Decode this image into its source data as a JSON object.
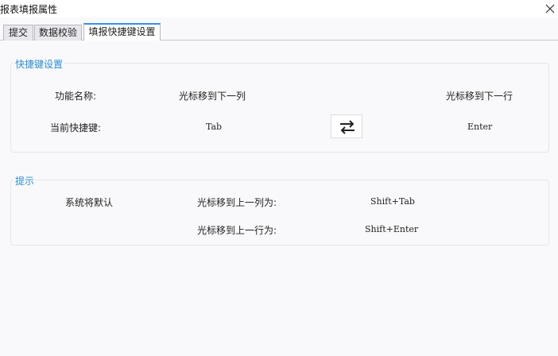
{
  "window": {
    "title": "报表填报属性",
    "close_icon": "close-icon"
  },
  "tabs": [
    {
      "label": "提交",
      "active": false
    },
    {
      "label": "数据校验",
      "active": false
    },
    {
      "label": "填报快捷键设置",
      "active": true
    }
  ],
  "shortcut_group": {
    "title": "快捷键设置",
    "function_label": "功能名称:",
    "function_col": "光标移到下一列",
    "function_row": "光标移到下一行",
    "current_label": "当前快捷键:",
    "current_col": "Tab",
    "current_row": "Enter",
    "swap_icon": "swap-arrows-icon"
  },
  "hint_group": {
    "title": "提示",
    "default_label": "系统将默认",
    "prev_col_label": "光标移到上一列为:",
    "prev_col_value": "Shift+Tab",
    "prev_row_label": "光标移到上一行为:",
    "prev_row_value": "Shift+Enter"
  },
  "colors": {
    "accent": "#2a8fd4",
    "tab_active_border": "#3a8ee6",
    "background": "#f9f9fb"
  }
}
